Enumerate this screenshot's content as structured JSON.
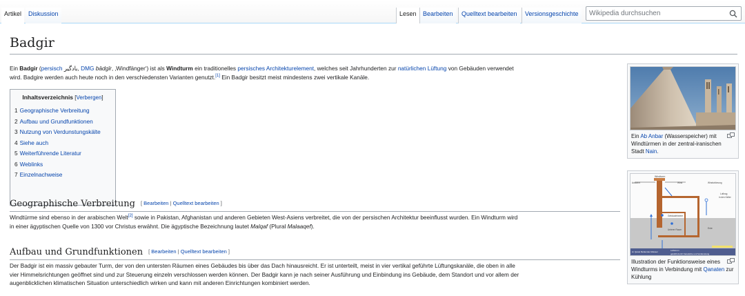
{
  "tabs": {
    "artikel": "Artikel",
    "diskussion": "Diskussion",
    "lesen": "Lesen",
    "bearbeiten": "Bearbeiten",
    "quelltext": "Quelltext bearbeiten",
    "versionen": "Versionsgeschichte"
  },
  "search": {
    "placeholder": "Wikipedia durchsuchen",
    "icon": "magnifier-icon"
  },
  "title": "Badgir",
  "intro": {
    "t1": "Ein ",
    "bold1": "Badgir",
    "t2": " (",
    "link_persisch": "persisch",
    "t3": " بادگیر, ",
    "link_dmg": "DMG",
    "t4": " ",
    "ital1": "bādgīr",
    "t5": ", ‚Windfänger‘) ist als ",
    "bold2": "Windturm",
    "t6": " ein traditionelles ",
    "link_arch": "persisches Architekturelement",
    "t7": ", welches seit Jahrhunderten zur ",
    "link_lueftung": "natürlichen Lüftung",
    "t8": " von Gebäuden verwendet",
    "t9": "wird. Badgire werden auch heute noch in den verschiedensten Varianten genutzt.",
    "ref1": "[1]",
    "t10": " Ein Badgir besitzt meist mindestens zwei vertikale Kanäle."
  },
  "toc": {
    "title": "Inhaltsverzeichnis",
    "toggle_open": " [",
    "toggle": "Verbergen",
    "toggle_close": "]",
    "items": [
      {
        "num": "1",
        "label": "Geographische Verbreitung"
      },
      {
        "num": "2",
        "label": "Aufbau und Grundfunktionen"
      },
      {
        "num": "3",
        "label": "Nutzung von Verdunstungskälte"
      },
      {
        "num": "4",
        "label": "Siehe auch"
      },
      {
        "num": "5",
        "label": "Weiterführende Literatur"
      },
      {
        "num": "6",
        "label": "Weblinks"
      },
      {
        "num": "7",
        "label": "Einzelnachweise"
      }
    ]
  },
  "section1": {
    "heading": "Geographische Verbreitung",
    "edit_open": "[ ",
    "edit": "Bearbeiten",
    "edit_sep": " | ",
    "edit_source": "Quelltext bearbeiten",
    "edit_close": " ]",
    "t1": "Windtürme sind ebenso in der arabischen Welt",
    "ref2": "[2]",
    "t2": " sowie in Pakistan, Afghanistan und anderen Gebieten West-Asiens verbreitet, die von der persischen Architektur beeinflusst wurden. Ein Windturm wird",
    "t3": "in einer ägyptischen Quelle von 1300 vor Christus erwähnt. Die ägyptische Bezeichnung lautet ",
    "ital1": "Malqaf",
    "t4": " (Plural ",
    "ital2": "Malaaqef",
    "t5": ")."
  },
  "section2": {
    "heading": "Aufbau und Grundfunktionen",
    "edit_open": "[ ",
    "edit": "Bearbeiten",
    "edit_sep": " | ",
    "edit_source": "Quelltext bearbeiten",
    "edit_close": " ]",
    "line1": "Der Badgir ist ein massiv gebauter Turm, der von den untersten Räumen eines Gebäudes bis über das Dach hinausreicht. Er ist unterteilt, meist in vier vertikal geführte Lüftungskanäle, die oben in alle",
    "line2": "vier Himmelsrichtungen geöffnet sind und zur Steuerung einzeln verschlossen werden können. Der Badgir kann je nach seiner Ausführung und Einbindung ins Gebäude, dem Standort und vor allem der",
    "line3": "augenblicklichen klimatischen Situation unterschiedlich wirken und kann mit anderen Einrichtungen kombiniert werden."
  },
  "thumb1": {
    "c1": "Ein ",
    "link1": "Ab Anbar",
    "c2": " (Wasserspeicher) mit Windtürmen in der zentral-iranischen Stadt ",
    "link2": "Nain",
    "c3": "."
  },
  "thumb2": {
    "c1": "Illustration der Funktionsweise eines Windturms in Verbindung mit ",
    "link1": "Qanaten",
    "c2": " zur Kühlung",
    "diagram_labels": {
      "top": "Windturm",
      "left": "Ausfahrt",
      "wind": "Wind",
      "stroemung": "Windströmung",
      "right1": "Luftzug",
      "right2": "in den Keller",
      "mid1": "Gebäudeinnere",
      "mid2": "Unterer Raum",
      "erde": "Erde",
      "bottom1": "im Qanat fließendes Wasser",
      "bottom2": "Luftstrom",
      "bottom3": "gekühlt durch Kanalsitze und Verdunstung"
    }
  }
}
